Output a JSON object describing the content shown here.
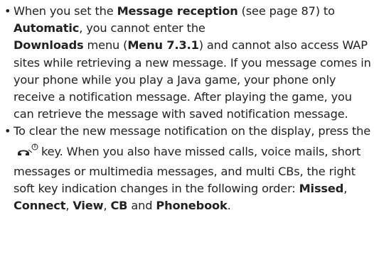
{
  "items": [
    {
      "segments": [
        {
          "t": "When you set the ",
          "b": false
        },
        {
          "t": "Message reception",
          "b": true
        },
        {
          "t": " (see page 87) to ",
          "b": false
        },
        {
          "t": "Automatic",
          "b": true
        },
        {
          "t": ", you cannot enter the ",
          "b": false
        },
        {
          "t": "Downloads",
          "b": true
        },
        {
          "t": " menu (",
          "b": false
        },
        {
          "t": "Menu 7.3.1",
          "b": true
        },
        {
          "t": ") and cannot also access WAP sites while retrieving a new message. If you message comes in your phone while you play a Java game, your phone only receive a notification message. After playing the game, you can retrieve the message with saved notification message.",
          "b": false
        }
      ]
    },
    {
      "before_icon": "To clear the new message notification on the display, press the",
      "icon": "end-call-key-icon",
      "after_icon": [
        {
          "t": "key. When you also have missed calls, voice mails, short messages or multimedia messages, and multi CBs, the right soft key indication changes in the following order: ",
          "b": false
        },
        {
          "t": "Missed",
          "b": true
        },
        {
          "t": ", ",
          "b": false
        },
        {
          "t": "Connect",
          "b": true
        },
        {
          "t": ", ",
          "b": false
        },
        {
          "t": "View",
          "b": true
        },
        {
          "t": ", ",
          "b": false
        },
        {
          "t": "CB",
          "b": true
        },
        {
          "t": " and ",
          "b": false
        },
        {
          "t": "Phonebook",
          "b": true
        },
        {
          "t": ".",
          "b": false
        }
      ]
    }
  ],
  "bullet_char": "•"
}
